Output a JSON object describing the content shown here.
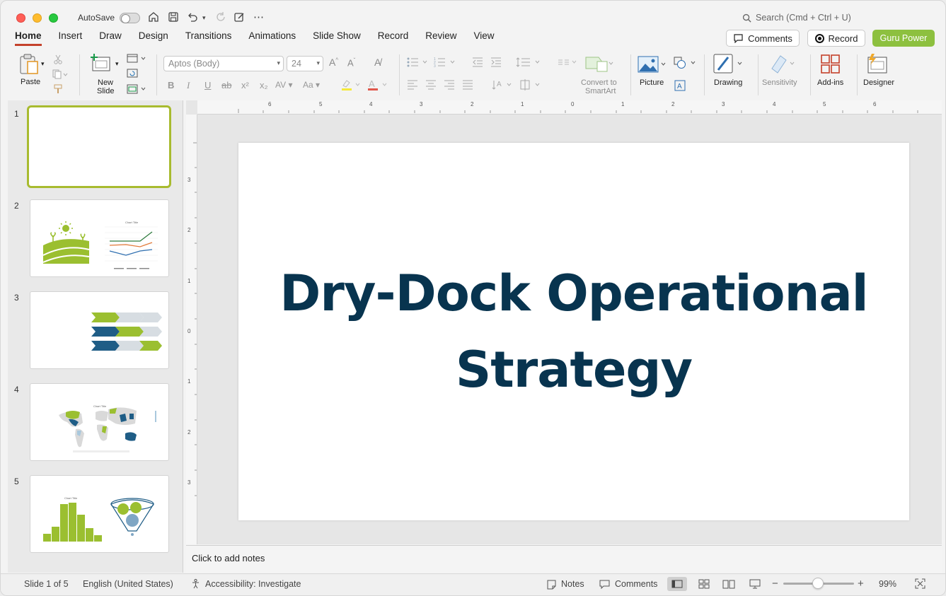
{
  "titlebar": {
    "autosave_label": "AutoSave",
    "search_placeholder": "Search (Cmd + Ctrl + U)"
  },
  "tabs": [
    {
      "label": "Home",
      "active": true
    },
    {
      "label": "Insert"
    },
    {
      "label": "Draw"
    },
    {
      "label": "Design"
    },
    {
      "label": "Transitions"
    },
    {
      "label": "Animations"
    },
    {
      "label": "Slide Show"
    },
    {
      "label": "Record"
    },
    {
      "label": "Review"
    },
    {
      "label": "View"
    }
  ],
  "top_buttons": {
    "comments": "Comments",
    "record": "Record",
    "guru": "Guru Power"
  },
  "ribbon": {
    "paste": "Paste",
    "new_slide_1": "New",
    "new_slide_2": "Slide",
    "font_name": "Aptos (Body)",
    "font_size": "24",
    "convert_1": "Convert to",
    "convert_2": "SmartArt",
    "picture": "Picture",
    "drawing": "Drawing",
    "sensitivity": "Sensitivity",
    "addins": "Add-ins",
    "designer": "Designer"
  },
  "slides": {
    "numbers": [
      "1",
      "2",
      "3",
      "4",
      "5"
    ],
    "thumb2_chart_title": "Chart Title",
    "thumb4_chart_title": "Chart Title",
    "thumb5_chart_title": "Chart Title"
  },
  "ruler": {
    "h_ticks": [
      "6",
      "5",
      "4",
      "3",
      "2",
      "1",
      "0",
      "1",
      "2",
      "3",
      "4",
      "5",
      "6"
    ],
    "v_ticks": [
      "3",
      "2",
      "1",
      "0",
      "1",
      "2",
      "3"
    ]
  },
  "slide": {
    "title_line1": "Dry-Dock Operational",
    "title_line2": "Strategy"
  },
  "notes": {
    "placeholder": "Click to add notes"
  },
  "status": {
    "slide_info": "Slide 1 of 5",
    "language": "English (United States)",
    "accessibility": "Accessibility: Investigate",
    "notes": "Notes",
    "comments": "Comments",
    "zoom": "99%"
  },
  "colors": {
    "accent_tab": "#c4412b",
    "guru_green": "#8dc03f",
    "title_navy": "#08344f",
    "thumb_green": "#9bbf30",
    "thumb_blue": "#1f5d86"
  }
}
